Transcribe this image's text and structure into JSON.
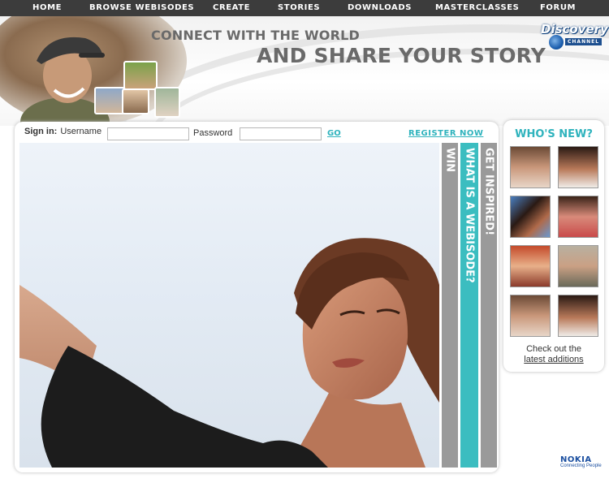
{
  "nav": {
    "items": [
      "HOME",
      "BROWSE WEBISODES",
      "CREATE",
      "STORIES",
      "DOWNLOADS",
      "MASTERCLASSES",
      "FORUM"
    ]
  },
  "header": {
    "tagline_1": "CONNECT WITH THE WORLD",
    "tagline_2": "AND SHARE YOUR STORY",
    "logo_text": "Discovery",
    "logo_sub": "CHANNEL"
  },
  "signin": {
    "label": "Sign in:",
    "username_label": "Username",
    "username_value": "",
    "password_label": "Password",
    "password_value": "",
    "go_label": "GO",
    "register_label": "REGISTER NOW"
  },
  "tabs": {
    "win": "WIN",
    "webisode": "WHAT IS A WEBISODE?",
    "inspired": "GET INSPIRED!"
  },
  "whos_new": {
    "title": "WHO'S NEW?",
    "check_text": "Check out the",
    "check_link": "latest additions"
  },
  "footer": {
    "brand": "NOKIA",
    "slogan": "Connecting People"
  },
  "colors": {
    "nav_bg": "#3c3c3c",
    "accent_teal": "#3bbdc0",
    "tab_gray": "#9a9a9a",
    "text_gray": "#6a6a6a",
    "nokia_blue": "#1b4fa0"
  }
}
